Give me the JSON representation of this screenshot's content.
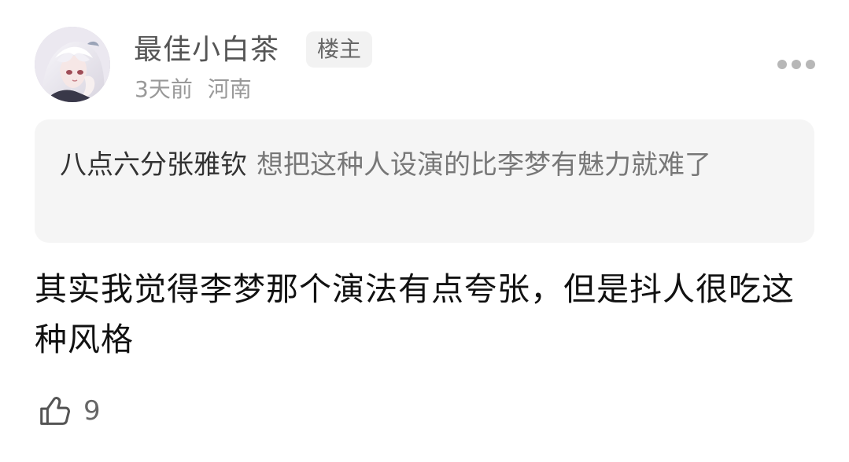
{
  "comment": {
    "user": {
      "name": "最佳小白茶",
      "badge": "楼主",
      "avatar_icon": "avatar-anime-girl"
    },
    "meta": {
      "time": "3天前",
      "location": "河南"
    },
    "quote": {
      "author": "八点六分张雅钦",
      "text": "想把这种人设演的比李梦有魅力就难了"
    },
    "body": "其实我觉得李梦那个演法有点夸张，但是抖人很吃这种风格",
    "likes": "9"
  },
  "colors": {
    "quote_bg": "#f5f5f5",
    "meta_text": "#999999",
    "body_text": "#111111"
  }
}
